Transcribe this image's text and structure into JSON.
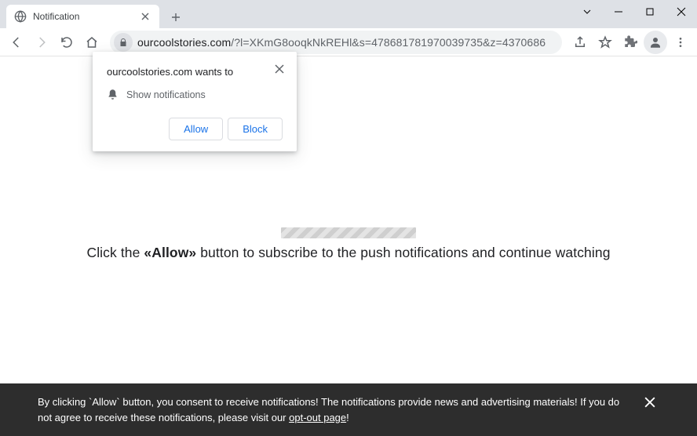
{
  "tab": {
    "title": "Notification"
  },
  "url": {
    "host": "ourcoolstories.com",
    "path": "/?l=XKmG8ooqkNkREHl&s=478681781970039735&z=4370686"
  },
  "prompt": {
    "title": "ourcoolstories.com wants to",
    "permission": "Show notifications",
    "allow_label": "Allow",
    "block_label": "Block"
  },
  "page": {
    "instruction_prefix": "Click the ",
    "instruction_bold": "«Allow»",
    "instruction_suffix": " button to subscribe to the push notifications and continue watching"
  },
  "consent": {
    "text_before": "By clicking `Allow` button, you consent to receive notifications! The notifications provide news and advertising materials! If you do not agree to receive these notifications, please visit our ",
    "link_text": "opt-out page",
    "text_after": "!"
  }
}
